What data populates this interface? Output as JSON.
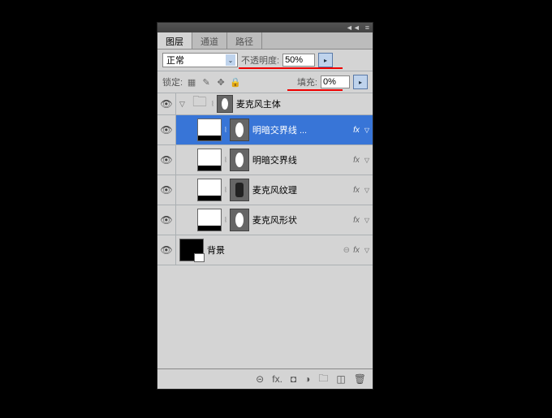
{
  "tabs": {
    "layers": "图层",
    "channels": "通道",
    "paths": "路径"
  },
  "blend": {
    "mode": "正常",
    "opacity_label": "不透明度:",
    "opacity_value": "50%"
  },
  "lock": {
    "label": "锁定:",
    "fill_label": "填充:",
    "fill_value": "0%"
  },
  "group": {
    "name": "麦克风主体"
  },
  "layers": [
    {
      "name": "明暗交界线  ...",
      "fx": "fx"
    },
    {
      "name": "明暗交界线",
      "fx": "fx"
    },
    {
      "name": "麦克风纹理",
      "fx": "fx"
    },
    {
      "name": "麦克风形状",
      "fx": "fx"
    }
  ],
  "bg": {
    "name": "背景",
    "fx": "fx"
  }
}
